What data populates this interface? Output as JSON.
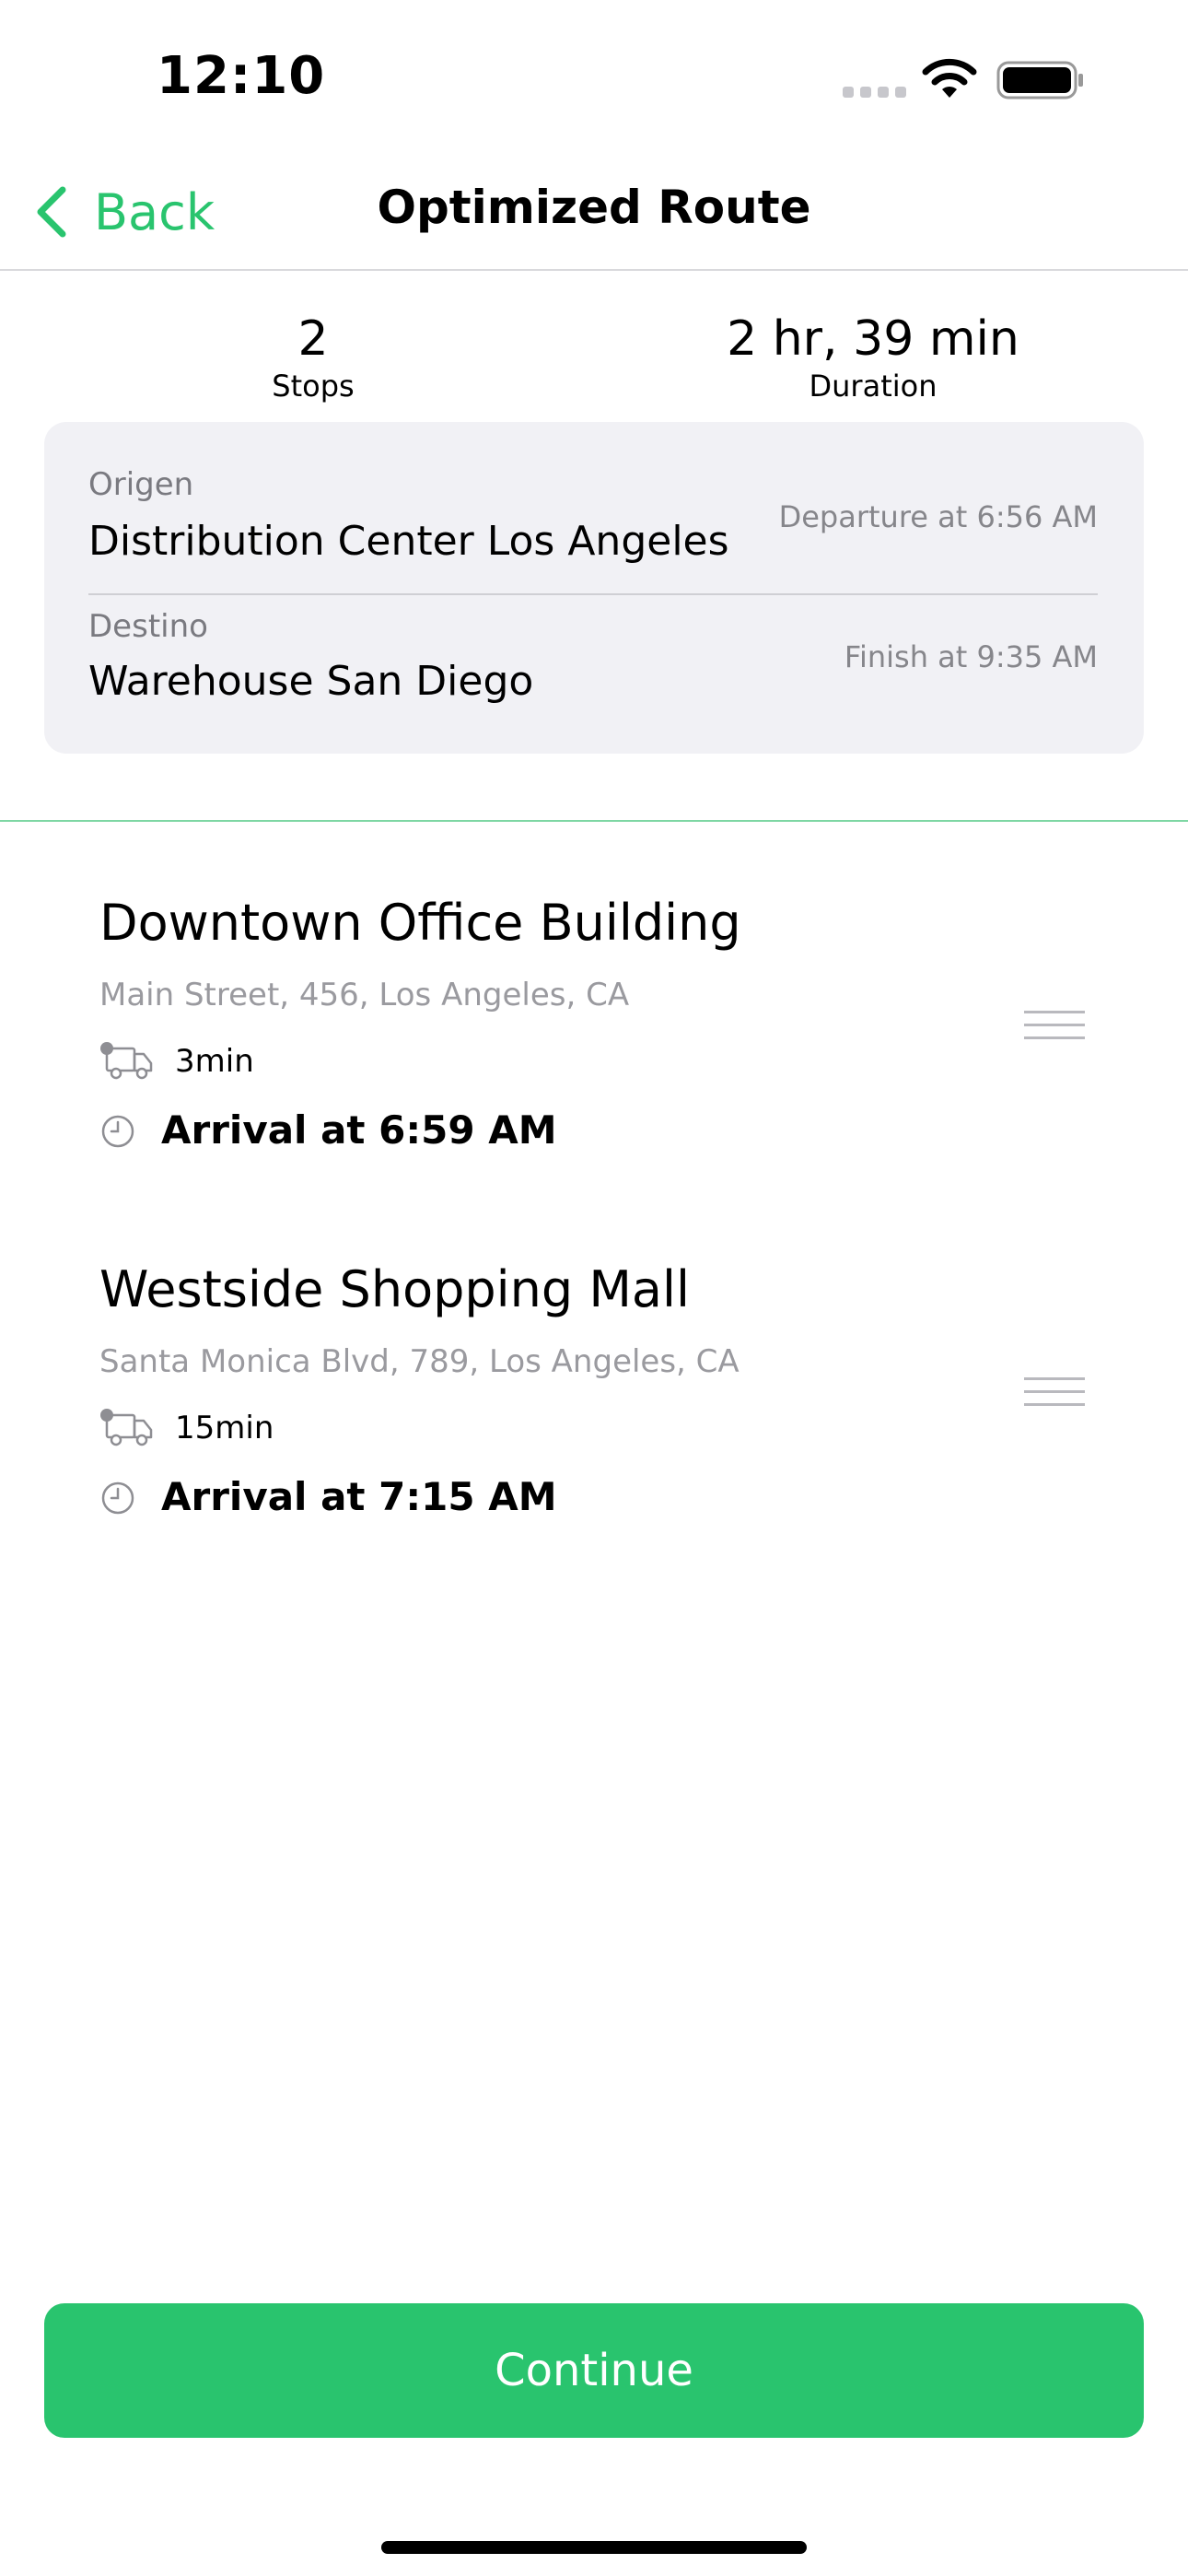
{
  "status_bar": {
    "time": "12:10",
    "icons": [
      "signal-dots-icon",
      "wifi-icon",
      "battery-icon"
    ]
  },
  "nav": {
    "back_label": "Back",
    "title": "Optimized Route"
  },
  "summary": {
    "stops_value": "2",
    "stops_label": "Stops",
    "duration_value": "2 hr, 39 min",
    "duration_label": "Duration"
  },
  "route": {
    "origin_label": "Origen",
    "origin_name": "Distribution Center Los Angeles",
    "departure": "Departure at 6:56 AM",
    "destination_label": "Destino",
    "destination_name": "Warehouse San Diego",
    "finish": "Finish at 9:35 AM"
  },
  "stops": [
    {
      "title": "Downtown Office Building",
      "address": "Main Street, 456, Los Angeles, CA",
      "duration": "3min",
      "arrival": "Arrival at 6:59 AM"
    },
    {
      "title": "Westside Shopping Mall",
      "address": "Santa Monica Blvd, 789, Los Angeles, CA",
      "duration": "15min",
      "arrival": "Arrival at 7:15 AM"
    }
  ],
  "continue_label": "Continue",
  "colors": {
    "accent": "#29c46e",
    "card_background": "#f1f1f5",
    "secondary_text": "#86868b"
  }
}
